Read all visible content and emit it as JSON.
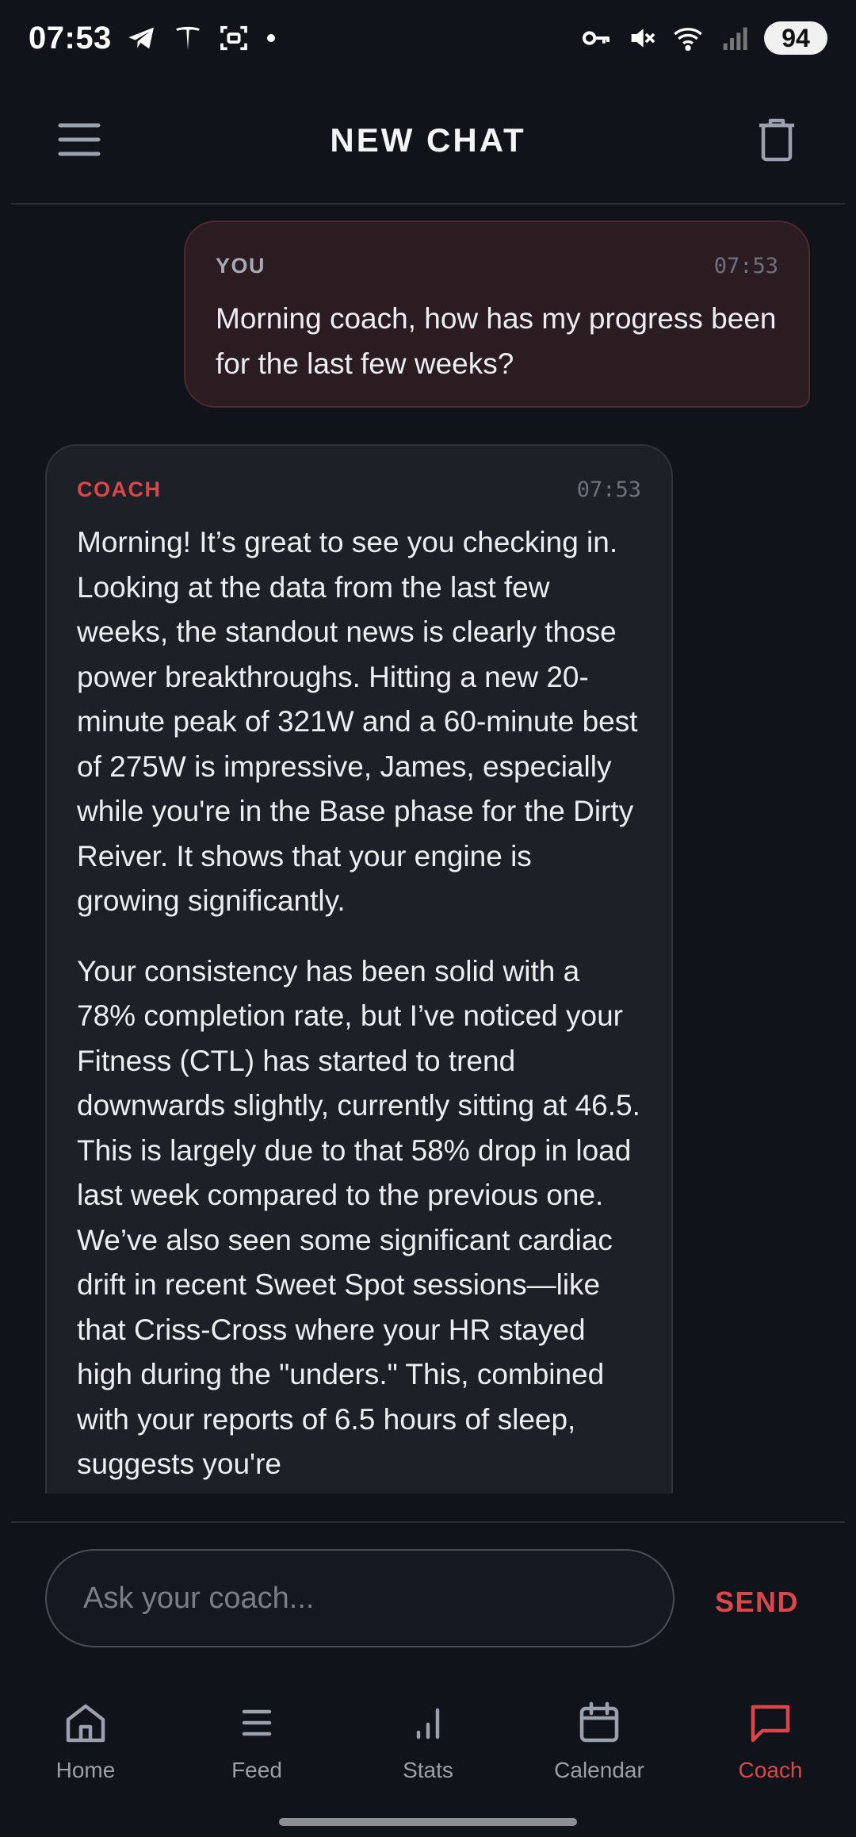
{
  "status_bar": {
    "time": "07:53",
    "battery": "94",
    "left_icons": [
      "telegram-icon",
      "tesla-icon",
      "screenshot-icon",
      "dot-icon"
    ],
    "right_icons": [
      "vpn-key-icon",
      "mute-icon",
      "wifi-icon",
      "signal-icon"
    ]
  },
  "header": {
    "title": "NEW CHAT",
    "menu_icon": "menu-icon",
    "trash_icon": "trash-icon"
  },
  "messages": [
    {
      "sender": "YOU",
      "time": "07:53",
      "text": "Morning coach, how has my progress been for the last few weeks?"
    },
    {
      "sender": "COACH",
      "time": "07:53",
      "paragraphs": [
        "Morning! It’s great to see you checking in. Looking at the data from the last few weeks, the standout news is clearly those power breakthroughs. Hitting a new 20-minute peak of 321W and a 60-minute best of 275W is impressive, James, especially while you're in the Base phase for the Dirty Reiver. It shows that your engine is growing significantly.",
        "Your consistency has been solid with a 78% completion rate, but I’ve noticed your Fitness (CTL) has started to trend downwards slightly, currently sitting at 46.5. This is largely due to that 58% drop in load last week compared to the previous one. We’ve also seen some significant cardiac drift in recent Sweet Spot sessions—like that Criss-Cross where your HR stayed high during the \"unders.\" This, combined with your reports of 6.5 hours of sleep, suggests you're"
      ]
    }
  ],
  "input": {
    "placeholder": "Ask your coach...",
    "value": "",
    "send_label": "SEND"
  },
  "nav": [
    {
      "label": "Home",
      "icon": "home-icon",
      "active": false
    },
    {
      "label": "Feed",
      "icon": "feed-icon",
      "active": false
    },
    {
      "label": "Stats",
      "icon": "stats-icon",
      "active": false
    },
    {
      "label": "Calendar",
      "icon": "calendar-icon",
      "active": false
    },
    {
      "label": "Coach",
      "icon": "chat-icon",
      "active": true
    }
  ],
  "colors": {
    "background": "#11131a",
    "accent": "#d9474a",
    "user_bubble": "#2a1c20",
    "coach_bubble": "#1d2027"
  }
}
